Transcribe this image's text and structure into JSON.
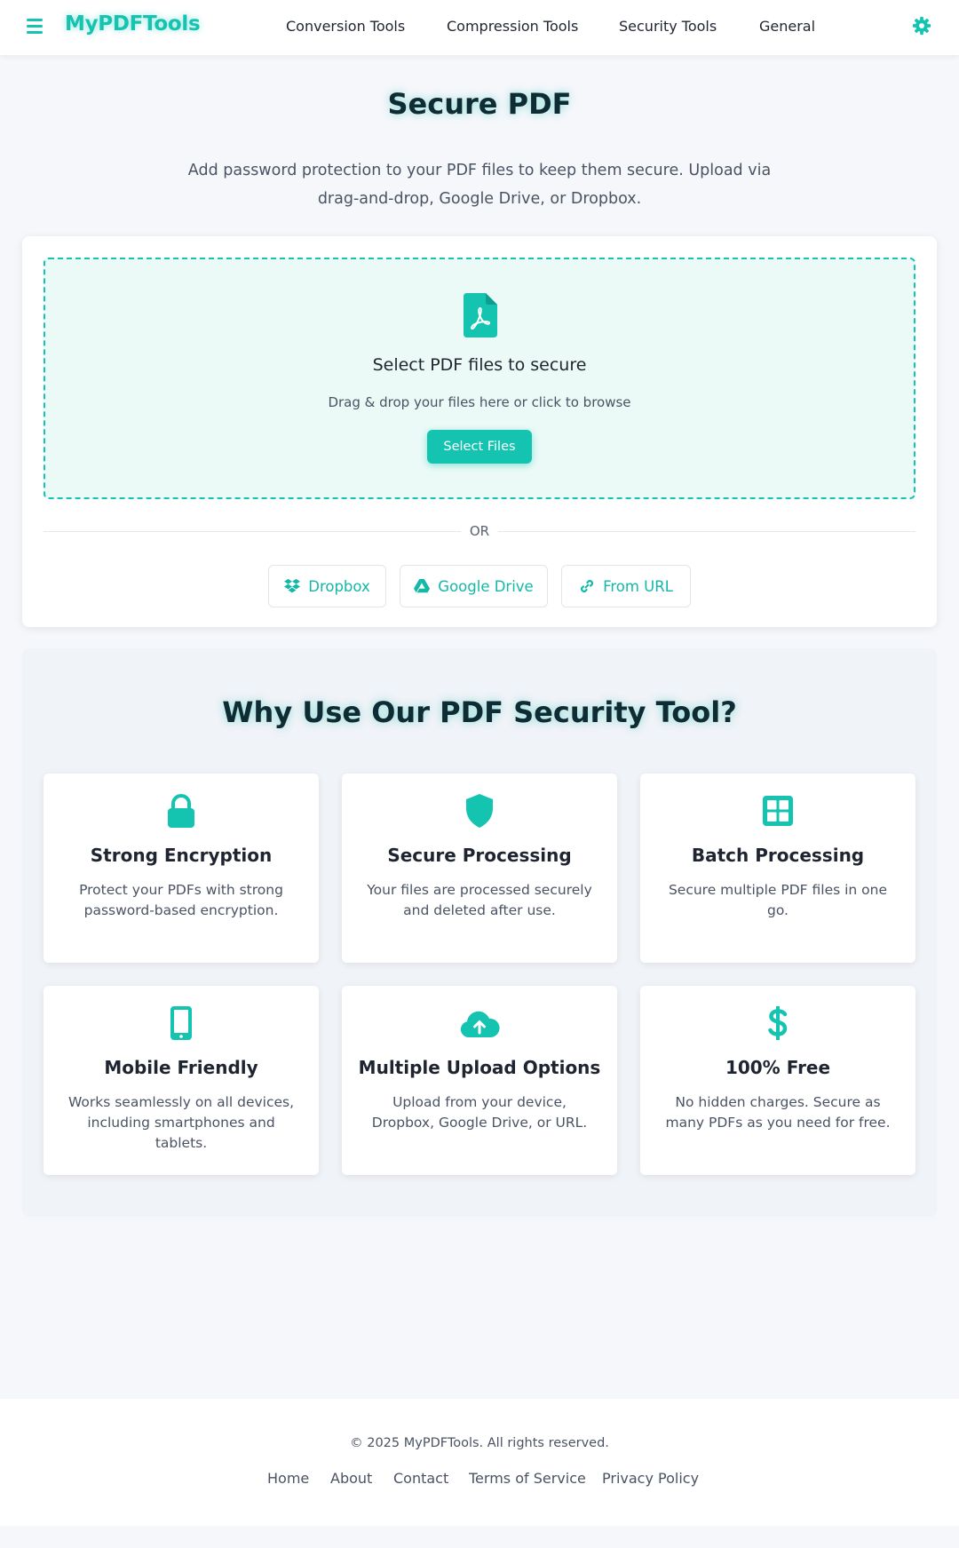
{
  "brand": {
    "name": "MyPDFTools",
    "accent": "#14c4b0"
  },
  "nav": {
    "items": [
      {
        "label": "Conversion Tools"
      },
      {
        "label": "Compression Tools"
      },
      {
        "label": "Security Tools"
      },
      {
        "label": "General"
      }
    ],
    "menu_icon": "hamburger-icon",
    "settings_icon": "gear-icon"
  },
  "hero": {
    "title": "Secure PDF",
    "description": "Add password protection to your PDF files to keep them secure. Upload via drag-and-drop, Google Drive, or Dropbox."
  },
  "upload": {
    "icon": "file-pdf-icon",
    "title": "Select PDF files to secure",
    "subtitle": "Drag & drop your files here or click to browse",
    "button_label": "Select Files",
    "or_label": "OR",
    "sources": [
      {
        "label": "Dropbox",
        "icon": "dropbox-icon"
      },
      {
        "label": "Google Drive",
        "icon": "google-drive-icon"
      },
      {
        "label": "From URL",
        "icon": "link-icon"
      }
    ]
  },
  "why": {
    "title": "Why Use Our PDF Security Tool?",
    "features": [
      {
        "icon": "lock-icon",
        "title": "Strong Encryption",
        "description": "Protect your PDFs with strong password-based encryption."
      },
      {
        "icon": "shield-icon",
        "title": "Secure Processing",
        "description": "Your files are processed securely and deleted after use."
      },
      {
        "icon": "grid-icon",
        "title": "Batch Processing",
        "description": "Secure multiple PDF files in one go."
      },
      {
        "icon": "mobile-icon",
        "title": "Mobile Friendly",
        "description": "Works seamlessly on all devices, including smartphones and tablets."
      },
      {
        "icon": "cloud-upload-icon",
        "title": "Multiple Upload Options",
        "description": "Upload from your device, Dropbox, Google Drive, or URL."
      },
      {
        "icon": "dollar-icon",
        "title": "100% Free",
        "description": "No hidden charges. Secure as many PDFs as you need for free."
      }
    ]
  },
  "footer": {
    "copyright": "© 2025 MyPDFTools. All rights reserved.",
    "links": [
      {
        "label": "Home"
      },
      {
        "label": "About"
      },
      {
        "label": "Contact"
      },
      {
        "label": "Terms of Service"
      },
      {
        "label": "Privacy Policy"
      }
    ]
  }
}
